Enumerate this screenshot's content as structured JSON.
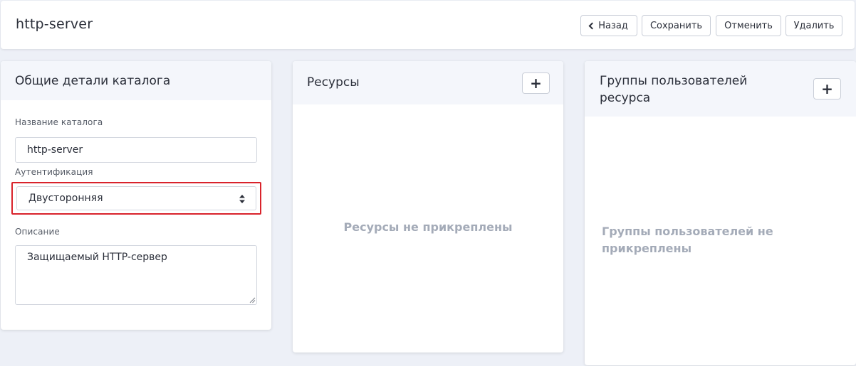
{
  "header": {
    "title": "http-server",
    "buttons": {
      "back": "Назад",
      "save": "Сохранить",
      "cancel": "Отменить",
      "delete": "Удалить"
    }
  },
  "details": {
    "title": "Общие детали каталога",
    "name_label": "Название каталога",
    "name_value": "http-server",
    "auth_label": "Аутентификация",
    "auth_value": "Двусторонняя",
    "desc_label": "Описание",
    "desc_value": "Защищаемый HTTP-сервер"
  },
  "resources": {
    "title": "Ресурсы",
    "add_label": "+",
    "empty_text": "Ресурсы не прикреплены"
  },
  "user_groups": {
    "title": "Группы пользователей ресурса",
    "add_label": "+",
    "empty_text": "Группы пользователей не прикреплены"
  },
  "colors": {
    "background": "#edf0f7",
    "card_header": "#f4f6fb",
    "highlight": "#d9232b",
    "muted_text": "#a4abb8"
  }
}
